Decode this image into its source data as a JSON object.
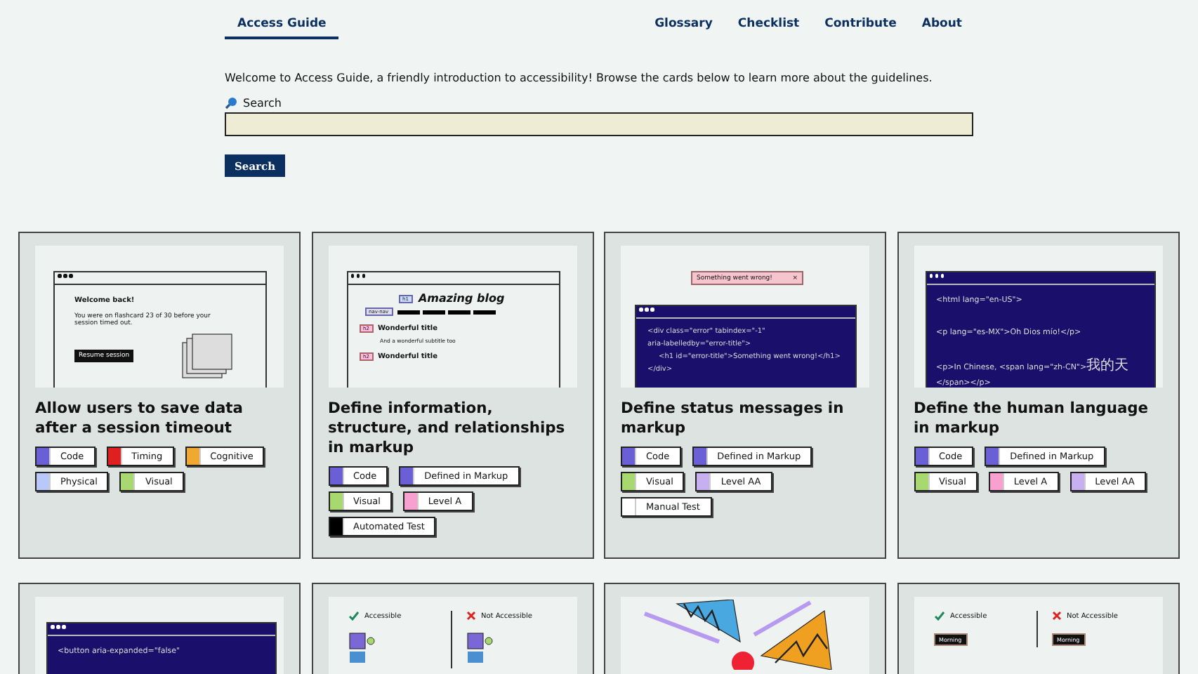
{
  "nav": {
    "brand": "Access Guide",
    "brand_selected": true,
    "links": [
      "Glossary",
      "Checklist",
      "Contribute",
      "About"
    ]
  },
  "intro": "Welcome to Access Guide, a friendly introduction to accessibility! Browse the cards below to learn more about the guidelines.",
  "search": {
    "label": "Search",
    "button": "Search"
  },
  "cards": [
    {
      "title": "Allow users to save data after a session timeout",
      "art": {
        "kind": "session",
        "heading": "Welcome back!",
        "body": "You were on flashcard 23 of 30 before your session timed out.",
        "button": "Resume session"
      },
      "tags": [
        {
          "label": "Code",
          "color": "#6b5fd6"
        },
        {
          "label": "Timing",
          "color": "#e02020"
        },
        {
          "label": "Cognitive",
          "color": "#f0a830"
        },
        {
          "label": "Physical",
          "color": "#b8c8f8"
        },
        {
          "label": "Visual",
          "color": "#a8d870"
        }
      ]
    },
    {
      "title": "Define information, structure, and relationships in markup",
      "art": {
        "kind": "blog",
        "title_tag": "h1",
        "title": "Amazing blog",
        "nav_tag": "nav-nav",
        "items": [
          {
            "tag": "h2",
            "title": "Wonderful title",
            "subtitle": "And a wonderful subtitle too"
          },
          {
            "tag": "h2",
            "title": "Wonderful title"
          }
        ]
      },
      "tags": [
        {
          "label": "Code",
          "color": "#6b5fd6"
        },
        {
          "label": "Defined in Markup",
          "color": "#6b5fd6"
        },
        {
          "label": "Visual",
          "color": "#a8d870"
        },
        {
          "label": "Level A",
          "color": "#f8a0d0"
        },
        {
          "label": "Automated Test",
          "color": "#000000"
        }
      ]
    },
    {
      "title": "Define status messages in markup",
      "art": {
        "kind": "status",
        "alert": "Something went wrong!",
        "close": "×",
        "lines": [
          {
            "text": "<div class=\"error\" tabindex=\"-1\"",
            "indented": false
          },
          {
            "text": "aria-labelledby=\"error-title\">",
            "indented": false
          },
          {
            "text": "<h1 id=\"error-title\">Something went wrong!</h1>",
            "indented": true
          },
          {
            "text": "</div>",
            "indented": false
          }
        ]
      },
      "tags": [
        {
          "label": "Code",
          "color": "#6b5fd6"
        },
        {
          "label": "Defined in Markup",
          "color": "#6b5fd6"
        },
        {
          "label": "Visual",
          "color": "#a8d870"
        },
        {
          "label": "Level AA",
          "color": "#c8b0f0"
        },
        {
          "label": "Manual Test",
          "color": "#ffffff"
        }
      ]
    },
    {
      "title": "Define the human language in markup",
      "art": {
        "kind": "code",
        "lines": [
          {
            "text": "<html lang=\"en-US\">"
          },
          {
            "text": "<p lang=\"es-MX\">Oh Dios mío!</p>"
          },
          {
            "text": "<p>In Chinese, <span lang=\"zh-CN\">",
            "cjk": "我的天",
            "rest": "</span></p>"
          }
        ]
      },
      "tags": [
        {
          "label": "Code",
          "color": "#6b5fd6"
        },
        {
          "label": "Defined in Markup",
          "color": "#6b5fd6"
        },
        {
          "label": "Visual",
          "color": "#a8d870"
        },
        {
          "label": "Level A",
          "color": "#f8a0d0"
        },
        {
          "label": "Level AA",
          "color": "#c8b0f0"
        }
      ]
    },
    {
      "art": {
        "kind": "code",
        "lines": [
          {
            "text": "<button aria-expanded=\"false\""
          }
        ]
      }
    },
    {
      "art": {
        "kind": "compare",
        "columns": [
          {
            "kind": "good",
            "label": "Accessible"
          },
          {
            "kind": "bad",
            "label": "Not Accessible"
          }
        ]
      }
    },
    {
      "art": {
        "kind": "abstract"
      }
    },
    {
      "art": {
        "kind": "compare",
        "columns": [
          {
            "kind": "good",
            "label": "Accessible",
            "chips": [
              "Morning"
            ]
          },
          {
            "kind": "bad",
            "label": "Not Accessible",
            "chips": [
              "Morning"
            ]
          }
        ]
      }
    }
  ]
}
